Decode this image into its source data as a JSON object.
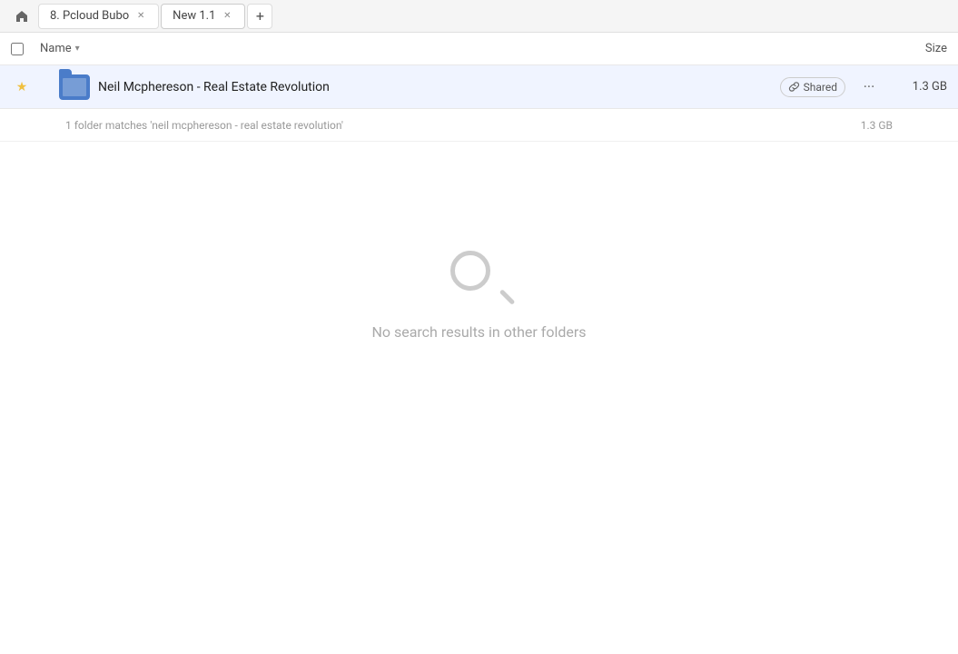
{
  "tabs": {
    "home_icon": "⌂",
    "tab1": {
      "label": "8. Pcloud Bubo",
      "active": false
    },
    "tab2": {
      "label": "New 1.1",
      "active": true
    },
    "add_icon": "+"
  },
  "column_headers": {
    "name_label": "Name",
    "chevron": "▾",
    "size_label": "Size"
  },
  "file_row": {
    "folder_name": "Neil Mcphereson - Real Estate Revolution",
    "shared_label": "Shared",
    "more_icon": "···",
    "size": "1.3 GB",
    "link_icon": "🔗"
  },
  "match_row": {
    "text": "1 folder matches 'neil mcphereson - real estate revolution'",
    "size": "1.3 GB"
  },
  "empty_state": {
    "message": "No search results in other folders"
  }
}
